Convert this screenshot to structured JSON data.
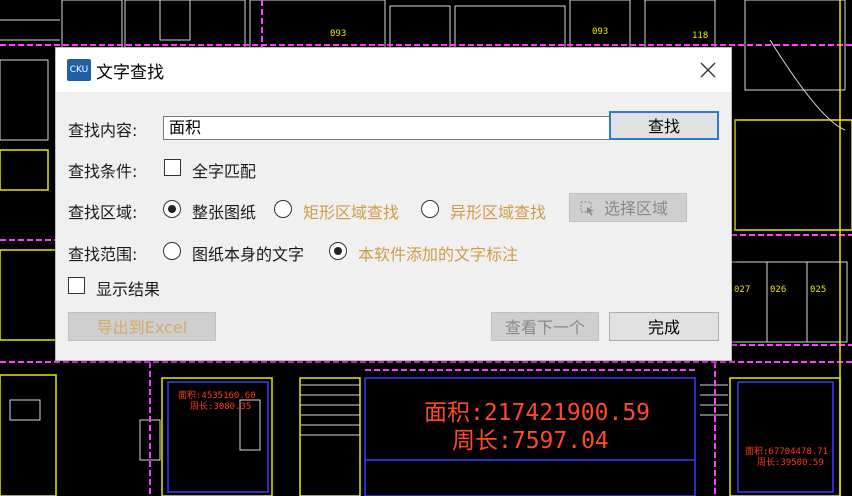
{
  "background": {
    "room_labels": [
      "093",
      "118",
      "027",
      "026",
      "025"
    ],
    "areas": [
      {
        "line1": "面积:4535160.60",
        "line2": "周长:3080.35",
        "color": "#ff3a1a"
      },
      {
        "line1": "面积:217421900.59",
        "line2": "周长:7597.04",
        "color": "#ff4a22"
      },
      {
        "line1": "面积:67704478.71",
        "line2": "周长:39500.59",
        "color": "#ff3a1a"
      }
    ]
  },
  "dialog": {
    "title": "文字查找",
    "app_icon_text": "CKU",
    "find_content": {
      "label": "查找内容:",
      "value": "面积"
    },
    "find_button": "查找",
    "find_condition": {
      "label": "查找条件:",
      "option": "全字匹配",
      "checked": false
    },
    "find_region": {
      "label": "查找区域:",
      "options": [
        "整张图纸",
        "矩形区域查找",
        "异形区域查找"
      ],
      "selected": "整张图纸",
      "select_button": "选择区域"
    },
    "find_scope": {
      "label": "查找范围:",
      "options": [
        "图纸本身的文字",
        "本软件添加的文字标注"
      ],
      "selected": "本软件添加的文字标注"
    },
    "show_results": {
      "label": "显示结果",
      "checked": false
    },
    "export_button": "导出到Excel",
    "next_button": "查看下一个",
    "done_button": "完成"
  },
  "colors": {
    "accent": "#2c7ad6",
    "disabled_text": "#d09a4a",
    "cad_magenta": "#ff3cff",
    "cad_yellow": "#e8e800"
  }
}
